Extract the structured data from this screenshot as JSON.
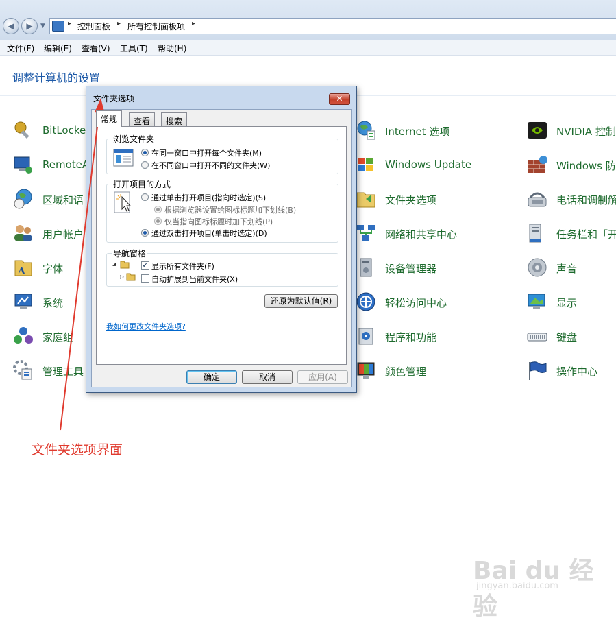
{
  "address": {
    "crumbs": [
      "控制面板",
      "所有控制面板项"
    ],
    "separator": "▸"
  },
  "menu": [
    "文件(F)",
    "编辑(E)",
    "查看(V)",
    "工具(T)",
    "帮助(H)"
  ],
  "heading": "调整计算机的设置",
  "items": [
    {
      "label": "BitLocke",
      "icon": "bitlocker-key-icon"
    },
    {
      "label": "RemoteA",
      "icon": "remoteapp-icon"
    },
    {
      "label": "区域和语",
      "icon": "region-globe-icon"
    },
    {
      "label": "用户帐户",
      "icon": "users-icon"
    },
    {
      "label": "字体",
      "icon": "fonts-folder-icon"
    },
    {
      "label": "系统",
      "icon": "system-monitor-icon"
    },
    {
      "label": "家庭组",
      "icon": "homegroup-icon"
    },
    {
      "label": "管理工具",
      "icon": "admin-tools-icon"
    },
    {
      "label": "Internet 选项",
      "icon": "internet-options-icon"
    },
    {
      "label": "Windows Update",
      "icon": "windows-update-icon"
    },
    {
      "label": "文件夹选项",
      "icon": "folder-options-icon"
    },
    {
      "label": "网络和共享中心",
      "icon": "network-center-icon"
    },
    {
      "label": "设备管理器",
      "icon": "device-manager-icon"
    },
    {
      "label": "轻松访问中心",
      "icon": "ease-of-access-icon"
    },
    {
      "label": "程序和功能",
      "icon": "programs-icon"
    },
    {
      "label": "颜色管理",
      "icon": "color-management-icon"
    },
    {
      "label": "NVIDIA 控制",
      "icon": "nvidia-icon"
    },
    {
      "label": "Windows 防",
      "icon": "firewall-icon"
    },
    {
      "label": "电话和调制解",
      "icon": "phone-modem-icon"
    },
    {
      "label": "任务栏和「开",
      "icon": "taskbar-icon"
    },
    {
      "label": "声音",
      "icon": "speaker-icon"
    },
    {
      "label": "显示",
      "icon": "display-icon"
    },
    {
      "label": "键盘",
      "icon": "keyboard-icon"
    },
    {
      "label": "操作中心",
      "icon": "action-center-flag-icon"
    }
  ],
  "dialog": {
    "title": "文件夹选项",
    "close": "✕",
    "tabs": [
      "常规",
      "查看",
      "搜索"
    ],
    "browse": {
      "label": "浏览文件夹",
      "opt1": "在同一窗口中打开每个文件夹(M)",
      "opt2": "在不同窗口中打开不同的文件夹(W)"
    },
    "open": {
      "label": "打开项目的方式",
      "opt1": "通过单击打开项目(指向时选定)(S)",
      "sub1": "根据浏览器设置给图标标题加下划线(B)",
      "sub2": "仅当指向图标标题时加下划线(P)",
      "opt2": "通过双击打开项目(单击时选定)(D)"
    },
    "nav": {
      "label": "导航窗格",
      "chk1": "显示所有文件夹(F)",
      "chk2": "自动扩展到当前文件夹(X)"
    },
    "restore": "还原为默认值(R)",
    "help_link": "我如何更改文件夹选项?",
    "ok": "确定",
    "cancel": "取消",
    "apply": "应用(A)"
  },
  "annotation": "文件夹选项界面",
  "watermark": {
    "brand": "Bai du 经验",
    "url": "jingyan.baidu.com"
  },
  "colors": {
    "link_green": "#1e6b2e",
    "heading_blue": "#1e5aa8",
    "annotation_red": "#e03a2e"
  }
}
